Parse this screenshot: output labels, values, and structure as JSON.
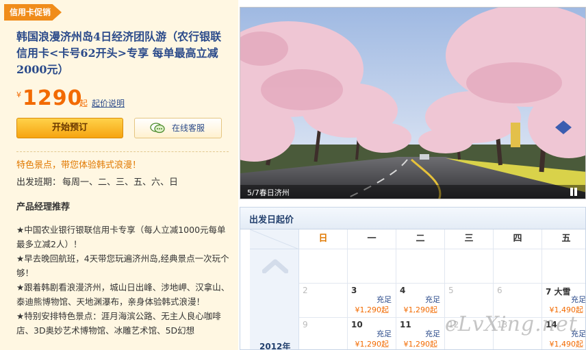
{
  "promo_tag": "信用卡促销",
  "product": {
    "title": "韩国浪漫济州岛4日经济团队游（农行银联信用卡<卡号62开头>专享 每单最高立减2000元）",
    "price_currency": "¥",
    "price_value": "1290",
    "price_suffix": "起",
    "price_help": "起价说明",
    "book_label": "开始预订",
    "chat_label": "在线客服",
    "feature": "特色景点，带您体验韩式浪漫！",
    "schedule_label": "出发班期：",
    "schedule_days": "每周一、二、三、五、六、日"
  },
  "manager": {
    "title": "产品经理推荐",
    "items": [
      "★中国农业银行银联信用卡专享（每人立减1000元每单最多立减2人）！",
      "★早去晚回航班，4天带您玩遍济州岛,经典景点一次玩个够！",
      "★跟着韩剧看浪漫济州，城山日出峰、涉地岬、汉拿山、泰迪熊博物馆、天地渊瀑布，亲身体验韩式浪漫！",
      "★特别安排特色景点：涯月海滨公路、无主人良心咖啡店、3D奥妙艺术博物馆、冰雕艺术馆、5D幻想"
    ]
  },
  "photo": {
    "caption": "5/7春日济州"
  },
  "calendar": {
    "title": "出发日起价",
    "year": "2012年",
    "weekdays": [
      "日",
      "一",
      "二",
      "三",
      "四",
      "五"
    ],
    "rows": [
      [
        {
          "num": "",
          "muted": false,
          "tag": "",
          "price": ""
        },
        {
          "num": "",
          "muted": false,
          "tag": "",
          "price": ""
        },
        {
          "num": "",
          "muted": false,
          "tag": "",
          "price": ""
        },
        {
          "num": "",
          "muted": false,
          "tag": "",
          "price": ""
        },
        {
          "num": "",
          "muted": false,
          "tag": "",
          "price": ""
        },
        {
          "num": "",
          "muted": false,
          "tag": "",
          "price": ""
        }
      ],
      [
        {
          "num": "2",
          "muted": true,
          "tag": "",
          "price": ""
        },
        {
          "num": "3",
          "muted": false,
          "tag": "充足",
          "price": "¥1,290起"
        },
        {
          "num": "4",
          "muted": false,
          "tag": "充足",
          "price": "¥1,290起"
        },
        {
          "num": "5",
          "muted": true,
          "tag": "",
          "price": ""
        },
        {
          "num": "6",
          "muted": true,
          "tag": "",
          "price": ""
        },
        {
          "num": "7 大雪",
          "muted": false,
          "tag": "充足",
          "price": "¥1,490起"
        }
      ],
      [
        {
          "num": "9",
          "muted": true,
          "tag": "",
          "price": ""
        },
        {
          "num": "10",
          "muted": false,
          "tag": "充足",
          "price": "¥1,290起"
        },
        {
          "num": "11",
          "muted": false,
          "tag": "充足",
          "price": "¥1,290起"
        },
        {
          "num": "12",
          "muted": true,
          "tag": "",
          "price": ""
        },
        {
          "num": "13",
          "muted": true,
          "tag": "",
          "price": ""
        },
        {
          "num": "14",
          "muted": false,
          "tag": "充足",
          "price": "¥1,490起"
        }
      ]
    ]
  },
  "watermark": "eLvXing.net"
}
